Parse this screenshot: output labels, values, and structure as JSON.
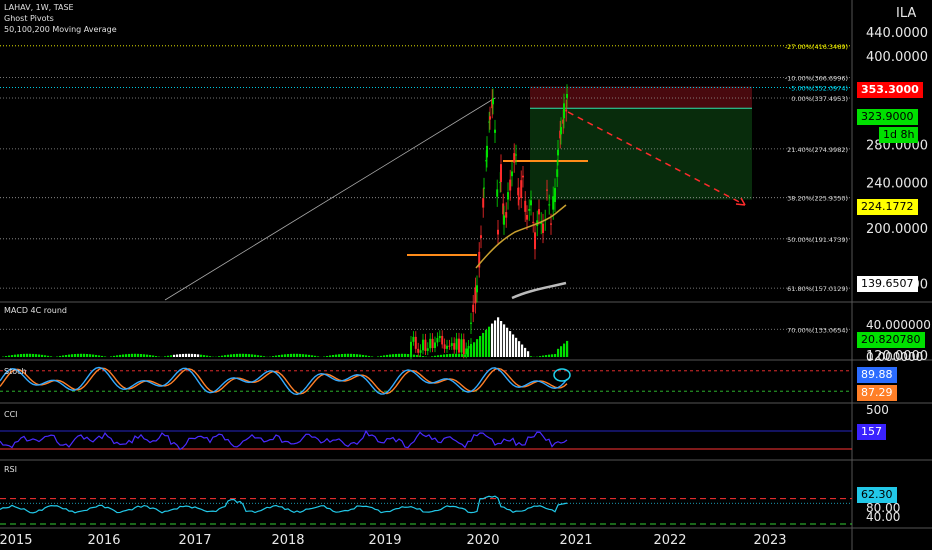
{
  "header": {
    "symbol_line": "LAHAV, 1W, TASE",
    "indicator_1": "Ghost Pivots",
    "indicator_2": "50,100,200 Moving Average"
  },
  "currency_label": "ILA",
  "panes": {
    "macd": "MACD 4C round",
    "stoch": "Stoch",
    "cci": "CCI",
    "rsi": "RSI"
  },
  "badges": {
    "target_price": "353.3000",
    "last_price": "323.9000",
    "countdown": "1d 8h",
    "stop_price": "224.1772",
    "ma200": "139.6507",
    "macd": "20.820780",
    "stoch_k": "89.88",
    "stoch_d": "87.29",
    "cci": "157",
    "rsi": "62.30"
  },
  "colors": {
    "background": "#000000",
    "up": "#00e000",
    "down": "#ff2b2b",
    "ma50": "#c8a030",
    "ma200": "#bbbbbb",
    "fib": "#9a9a9a",
    "label_yellow": "#ffff00",
    "label_red": "#ff0000",
    "label_green": "#00e000",
    "stoch_k": "#33aaff",
    "stoch_d": "#ff7f27",
    "cci_line": "#4a2bff",
    "rsi_line": "#22c8e8"
  },
  "chart_data": {
    "type": "candlestick",
    "x_ticks": [
      "2015",
      "2016",
      "2017",
      "2018",
      "2019",
      "2020",
      "2021",
      "2022",
      "2023"
    ],
    "price_axis": {
      "scale": "log",
      "ticks": [
        "440.0000",
        "400.0000",
        "280.0000",
        "240.0000",
        "200.0000",
        "160.0000",
        "120.0000"
      ]
    },
    "fib_levels": [
      {
        "label": "-27.00%(416.3469)",
        "value": 416.3469,
        "color": "#ffff00"
      },
      {
        "label": "-10.00%(366.6996)",
        "value": 366.6996
      },
      {
        "label": "-5.00%(352.0974)",
        "value": 352.0974,
        "color": "#00e5ff"
      },
      {
        "label": "0.00%(337.4953)",
        "value": 337.4953
      },
      {
        "label": "21.40%(274.9982)",
        "value": 274.9982
      },
      {
        "label": "38.20%(225.9350)",
        "value": 225.935
      },
      {
        "label": "50.00%(191.4739)",
        "value": 191.4739
      },
      {
        "label": "61.80%(157.0129)",
        "value": 157.0129
      },
      {
        "label": "70.00%(133.0654)",
        "value": 133.0654
      }
    ],
    "position": {
      "entry": 323.9,
      "target": 353.3,
      "stop": 224.1772
    },
    "macd": {
      "axis_ticks": [
        "40.000000",
        "0.000000"
      ],
      "value": 20.82078
    },
    "stoch": {
      "k": 89.88,
      "d": 87.29,
      "overbought": 80,
      "oversold": 20
    },
    "cci": {
      "axis_ticks": [
        "500"
      ],
      "value": 157
    },
    "rsi": {
      "axis_ticks": [
        "80.00",
        "40.00"
      ],
      "value": 62.3,
      "levels": [
        70,
        30
      ]
    }
  }
}
